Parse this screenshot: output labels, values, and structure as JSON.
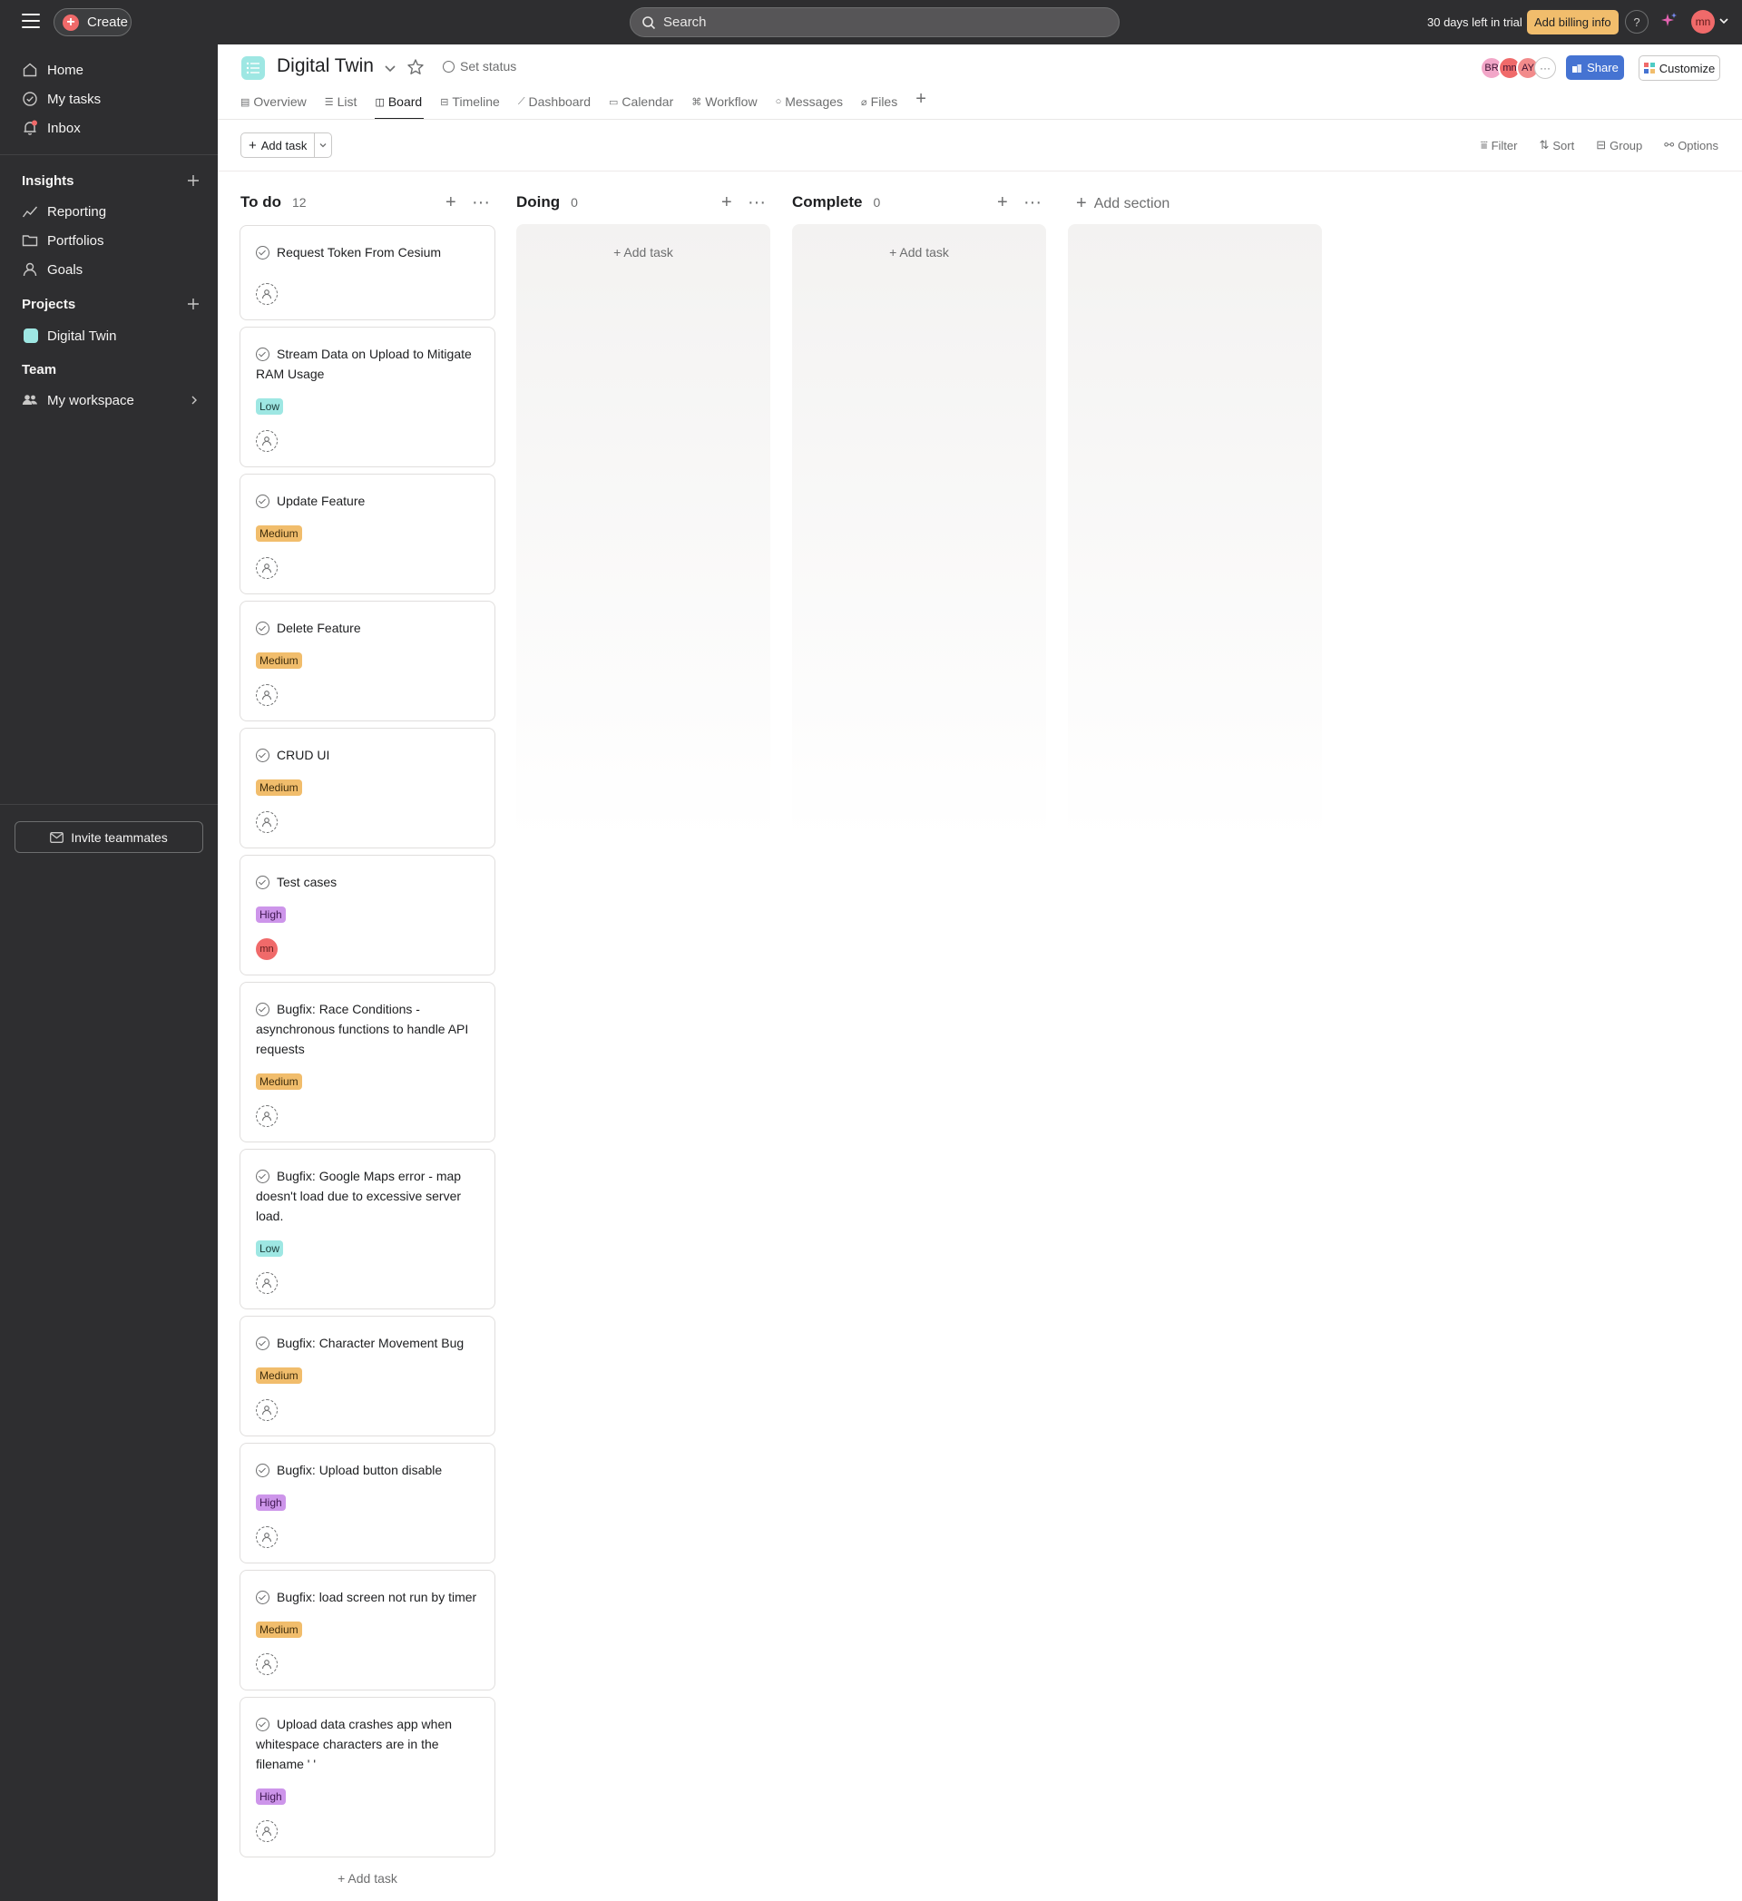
{
  "topbar": {
    "create_label": "Create",
    "search_placeholder": "Search",
    "trial_text": "30 days left in trial",
    "billing_label": "Add billing info",
    "help_label": "?",
    "user_initials": "mn"
  },
  "sidebar": {
    "nav": [
      {
        "label": "Home",
        "icon": "home-icon"
      },
      {
        "label": "My tasks",
        "icon": "check-circle-icon"
      },
      {
        "label": "Inbox",
        "icon": "bell-icon"
      }
    ],
    "insights_label": "Insights",
    "insights": [
      {
        "label": "Reporting",
        "icon": "chart-line-icon"
      },
      {
        "label": "Portfolios",
        "icon": "folder-icon"
      },
      {
        "label": "Goals",
        "icon": "person-icon"
      }
    ],
    "projects_label": "Projects",
    "projects": [
      {
        "label": "Digital Twin",
        "color": "#9ee7e3"
      }
    ],
    "team_label": "Team",
    "team": [
      {
        "label": "My workspace",
        "icon": "people-icon"
      }
    ],
    "invite_label": "Invite teammates"
  },
  "project": {
    "title": "Digital Twin",
    "set_status_label": "Set status",
    "members": [
      {
        "initials": "BR",
        "color": "#f2a6c8"
      },
      {
        "initials": "mn",
        "color": "#f06a6a"
      },
      {
        "initials": "AY",
        "color": "#f28b8b"
      }
    ],
    "more_members": "···",
    "share_label": "Share",
    "customize_label": "Customize",
    "tabs": [
      {
        "label": "Overview",
        "icon": "overview-icon"
      },
      {
        "label": "List",
        "icon": "list-icon"
      },
      {
        "label": "Board",
        "icon": "board-icon",
        "active": true
      },
      {
        "label": "Timeline",
        "icon": "timeline-icon"
      },
      {
        "label": "Dashboard",
        "icon": "dashboard-icon"
      },
      {
        "label": "Calendar",
        "icon": "calendar-icon"
      },
      {
        "label": "Workflow",
        "icon": "workflow-icon"
      },
      {
        "label": "Messages",
        "icon": "messages-icon"
      },
      {
        "label": "Files",
        "icon": "files-icon"
      }
    ]
  },
  "toolbar": {
    "add_task_label": "Add task",
    "filter_label": "Filter",
    "sort_label": "Sort",
    "group_label": "Group",
    "options_label": "Options"
  },
  "board": {
    "columns": [
      {
        "name": "To do",
        "count": "12"
      },
      {
        "name": "Doing",
        "count": "0"
      },
      {
        "name": "Complete",
        "count": "0"
      }
    ],
    "add_task_label": "+ Add task",
    "add_section_label": "Add section",
    "cards": [
      {
        "title": "Request Token From Cesium",
        "priority": "",
        "assignee": ""
      },
      {
        "title": "Stream Data on Upload to Mitigate RAM Usage",
        "priority": "Low",
        "assignee": ""
      },
      {
        "title": "Update Feature",
        "priority": "Medium",
        "assignee": ""
      },
      {
        "title": "Delete Feature",
        "priority": "Medium",
        "assignee": ""
      },
      {
        "title": "CRUD UI",
        "priority": "Medium",
        "assignee": ""
      },
      {
        "title": "Test cases",
        "priority": "High",
        "assignee": "mn"
      },
      {
        "title": "Bugfix: Race Conditions - asynchronous functions to handle API requests",
        "priority": "Medium",
        "assignee": ""
      },
      {
        "title": "Bugfix: Google Maps error - map doesn't load due to excessive server load.",
        "priority": "Low",
        "assignee": ""
      },
      {
        "title": "Bugfix: Character Movement Bug",
        "priority": "Medium",
        "assignee": ""
      },
      {
        "title": "Bugfix: Upload button disable",
        "priority": "High",
        "assignee": ""
      },
      {
        "title": "Bugfix: load screen not run by timer",
        "priority": "Medium",
        "assignee": ""
      },
      {
        "title": "Upload data crashes app when whitespace characters are in the filename ' '",
        "priority": "High",
        "assignee": ""
      }
    ]
  }
}
